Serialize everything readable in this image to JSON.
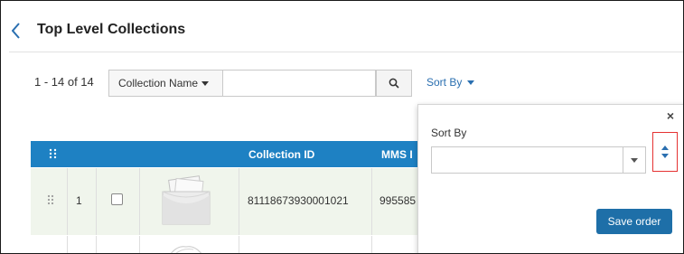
{
  "header": {
    "title": "Top Level Collections"
  },
  "toolbar": {
    "count_text": "1 - 14 of 14",
    "field_selector_label": "Collection Name",
    "search_value": "",
    "sort_by_label": "Sort By"
  },
  "table": {
    "columns": [
      "Collection ID",
      "MMS I"
    ],
    "rows": [
      {
        "index": "1",
        "collection_id": "81118673930001021",
        "mms_id": "995585",
        "checked": false
      }
    ]
  },
  "sort_popup": {
    "label": "Sort By",
    "selected_value": "",
    "save_label": "Save order",
    "close_label": "×"
  },
  "colors": {
    "accent": "#1e81c3",
    "link": "#2a6fb0",
    "button": "#1e6fa8",
    "highlight_box": "#e53232",
    "row_bg": "#f0f5ec"
  },
  "icons": {
    "back": "chevron-left-icon",
    "search": "search-icon",
    "grid": "grid-dots-icon",
    "drag": "drag-handle-icon",
    "thumbnail": "collection-thumbnail-icon",
    "sort_order": "sort-order-icon"
  }
}
